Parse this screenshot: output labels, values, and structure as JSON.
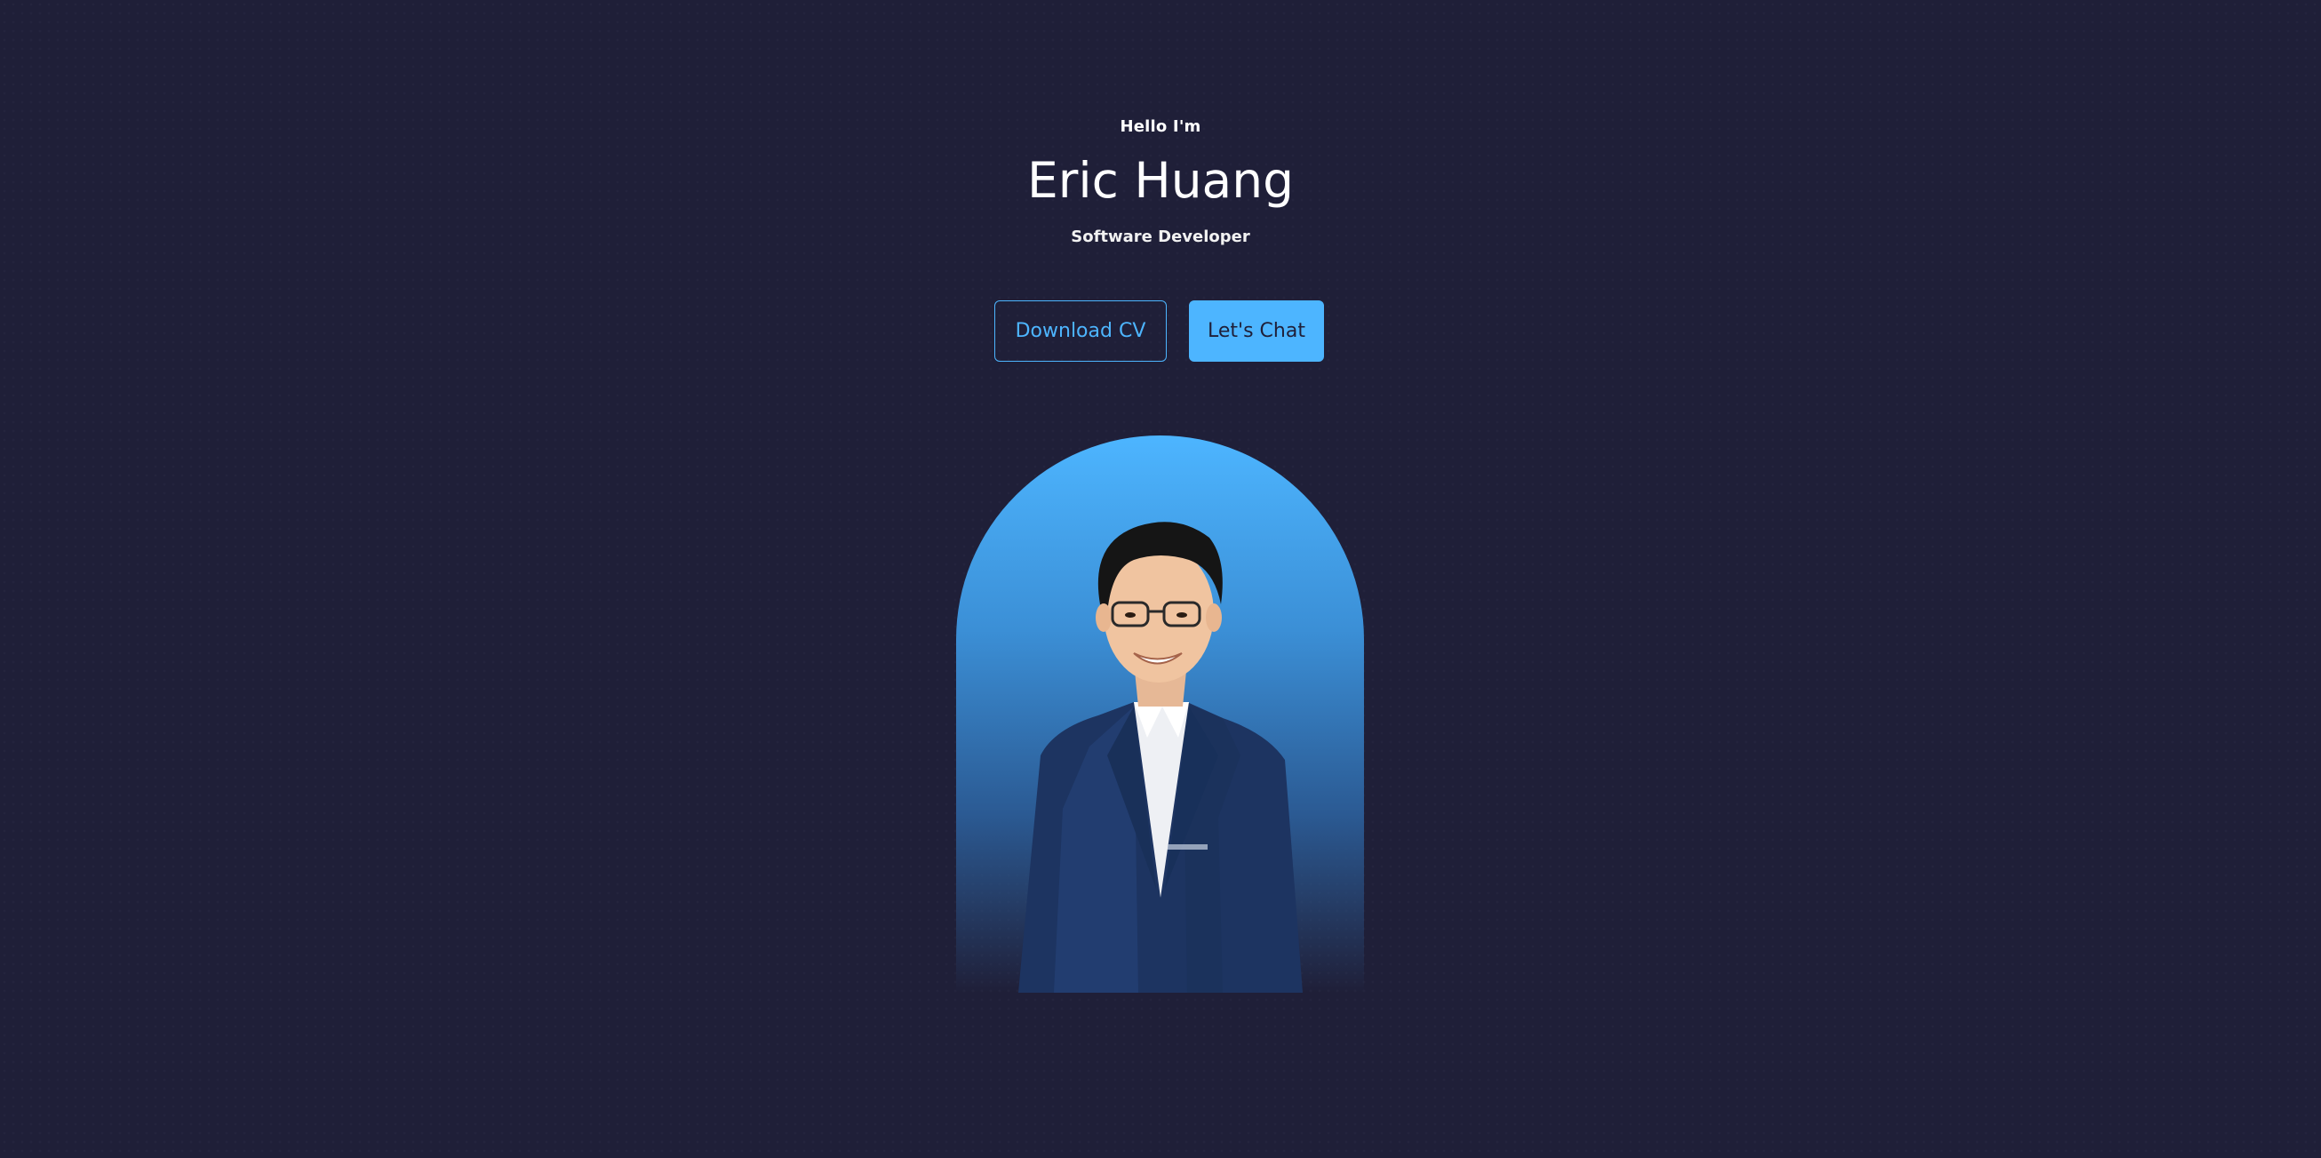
{
  "hero": {
    "greeting": "Hello I'm",
    "name": "Eric Huang",
    "role": "Software Developer"
  },
  "cta": {
    "download_label": "Download CV",
    "chat_label": "Let's Chat"
  },
  "portrait": {
    "alt": "Portrait of Eric Huang"
  },
  "colors": {
    "background": "#1f1f38",
    "accent": "#4db5ff"
  }
}
